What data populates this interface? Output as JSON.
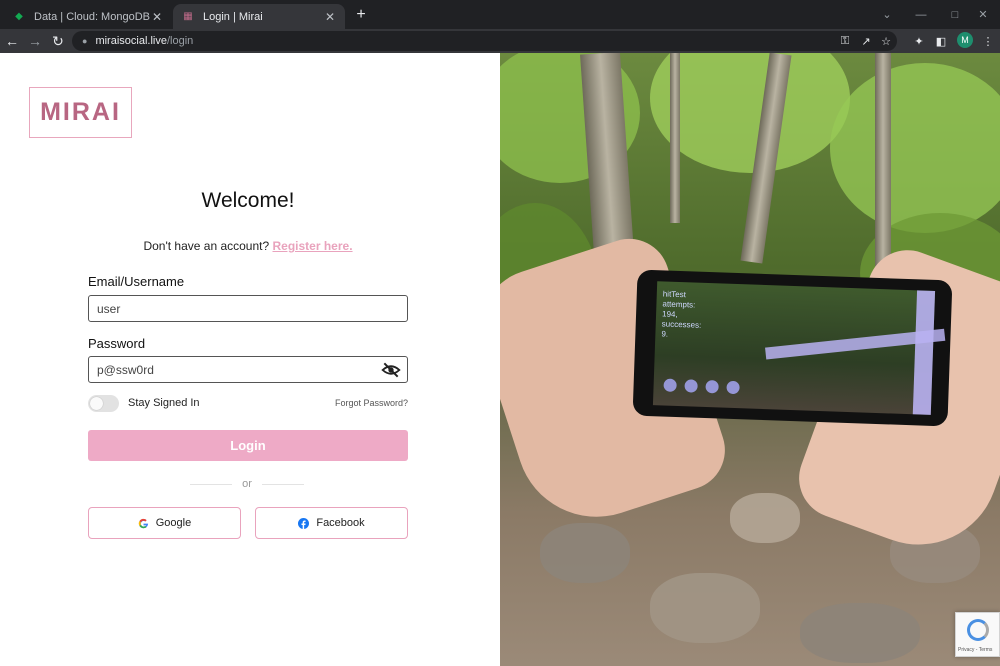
{
  "browser": {
    "tabs": [
      {
        "title": "Data | Cloud: MongoDB Cloud",
        "favicon": "mongodb-leaf-icon",
        "active": false
      },
      {
        "title": "Login | Mirai",
        "favicon": "mirai-icon",
        "active": true
      }
    ],
    "url_host": "miraisocial.live",
    "url_path": "/login",
    "profile_initial": "M"
  },
  "brand": {
    "logo_text": "MIRAI",
    "accent": "#eeaac6",
    "logo_color": "#b86682"
  },
  "login": {
    "heading": "Welcome!",
    "no_account_text": "Don't have an account?",
    "register_link": "Register here.",
    "email_label": "Email/Username",
    "email_value": "user",
    "password_label": "Password",
    "password_value": "p@ssw0rd",
    "stay_signed_in": "Stay Signed In",
    "forgot_password": "Forgot Password?",
    "login_button": "Login",
    "or": "or",
    "google_button": "Google",
    "facebook_button": "Facebook"
  },
  "photo": {
    "phone_overlay": [
      "hitTest",
      "attempts:",
      "194,",
      "successes:",
      "9."
    ]
  },
  "recaptcha": {
    "text": "Privacy - Terms"
  }
}
